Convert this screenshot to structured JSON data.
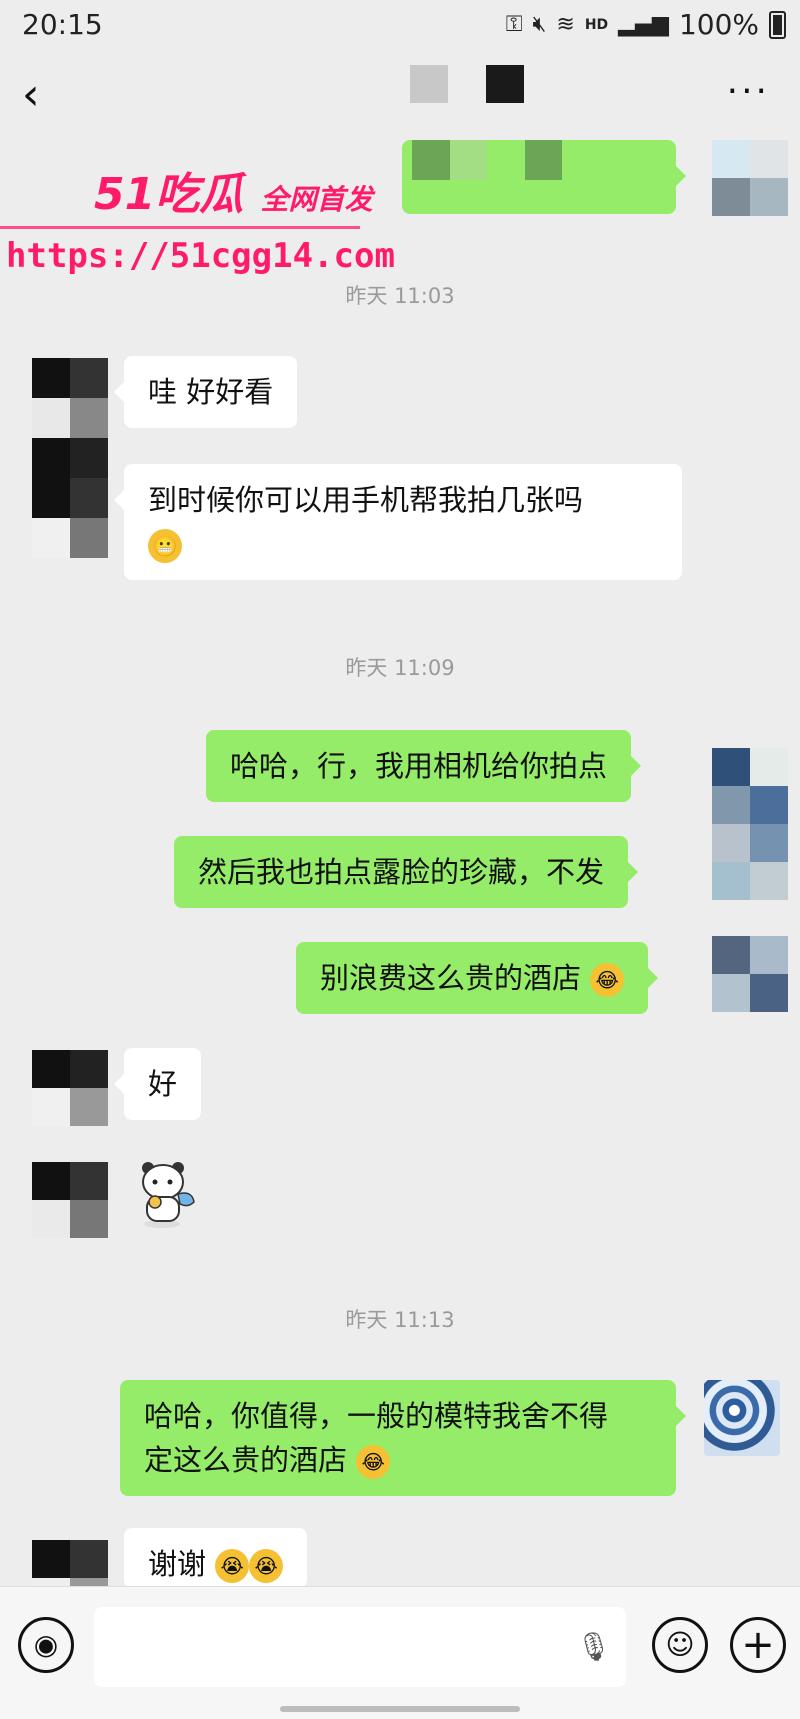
{
  "status_bar": {
    "time": "20:15",
    "hd": "HD",
    "battery_percent": "100%"
  },
  "header": {
    "back_icon": "chevron-left-icon",
    "more_icon": "more-icon"
  },
  "watermark": {
    "brand_number": "51",
    "brand_text": "吃瓜",
    "slogan": "全网首发",
    "url": "https://51cgg14.com"
  },
  "messages": {
    "time1": "昨天 11:03",
    "m1": "哇 好好看",
    "m2": "到时候你可以用手机帮我拍几张吗",
    "time2": "昨天 11:09",
    "m3": "哈哈，行，我用相机给你拍点",
    "m4": "然后我也拍点露脸的珍藏，不发",
    "m5": "别浪费这么贵的酒店",
    "m6": "好",
    "time3": "昨天 11:13",
    "m7_line1": "哈哈，你值得，一般的模特我舍不得",
    "m7_line2": "定这么贵的酒店",
    "m8": "谢谢"
  },
  "input_bar": {
    "placeholder": ""
  },
  "colors": {
    "background": "#ededed",
    "sent_bubble": "#95ec69",
    "received_bubble": "#ffffff",
    "watermark": "#ff1a6a"
  }
}
